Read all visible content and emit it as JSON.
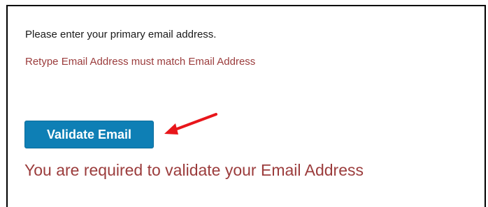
{
  "form": {
    "instruction": "Please enter your primary email address.",
    "mismatch_error": "Retype Email Address must match Email Address",
    "validate_button_label": "Validate Email",
    "required_error": "You are required to validate your Email Address"
  },
  "annotation": {
    "arrow_color": "#e8161b"
  },
  "colors": {
    "error_text": "#9b3c3c",
    "button_bg": "#0e7fb5",
    "button_text": "#ffffff"
  }
}
